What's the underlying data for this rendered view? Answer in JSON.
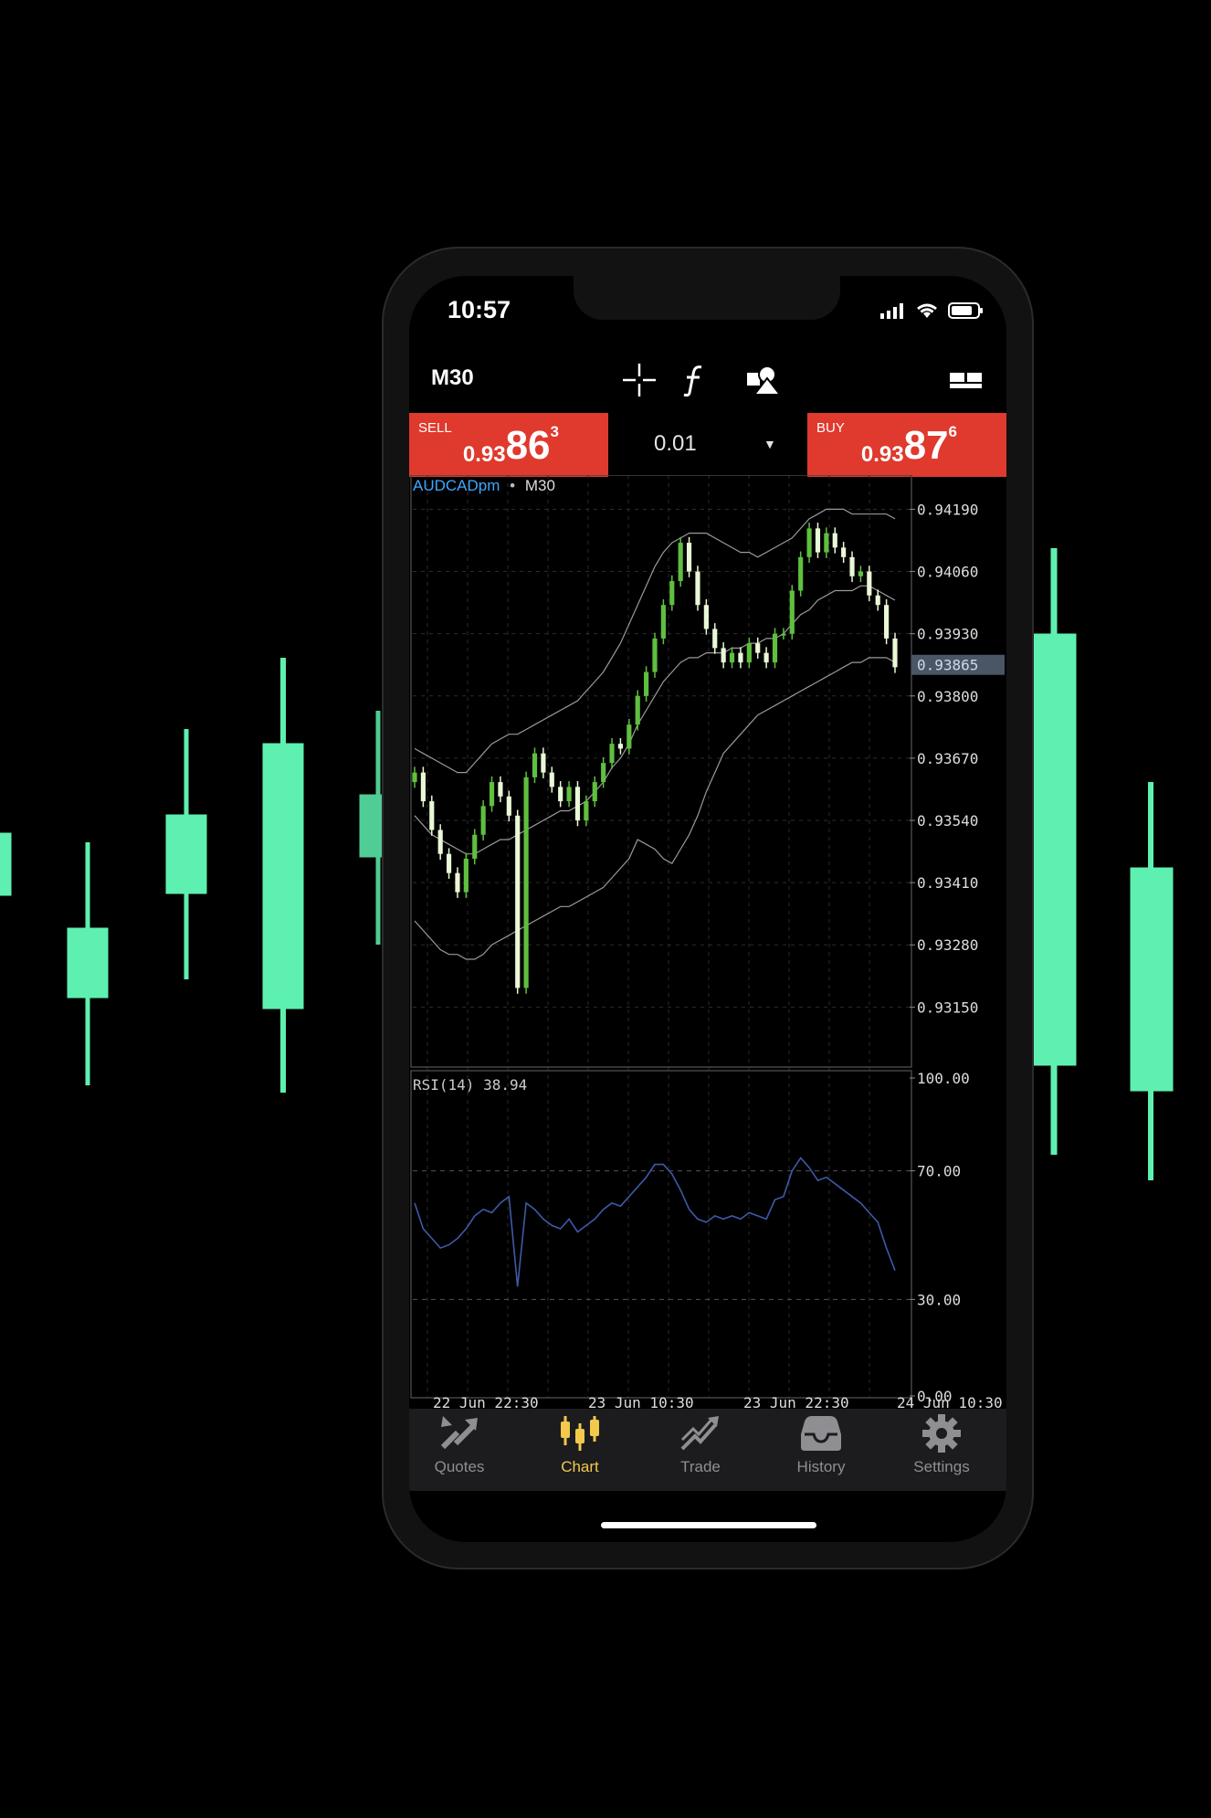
{
  "colors": {
    "background": "#000000",
    "deco_candle": "#5ef0b0",
    "sell_buy_button": "#e0392d",
    "active_tab": "#f2c94c",
    "inactive_tab": "#8e8e93",
    "candle_bull": "#5fbf3f",
    "candle_bear": "#e9f8d6",
    "rsi_line": "#3e5aa8",
    "symbol_label": "#3fa8ff"
  },
  "status_bar": {
    "time": "10:57",
    "icons": [
      "signal-icon",
      "wifi-icon",
      "battery-icon"
    ]
  },
  "toolbar": {
    "timeframe": "M30",
    "icons": [
      "crosshair-icon",
      "indicators-icon",
      "objects-icon",
      "multi-chart-icon"
    ]
  },
  "trade": {
    "sell": {
      "label": "SELL",
      "price_small": "0.93",
      "price_big": "86",
      "price_sup": "3"
    },
    "buy": {
      "label": "BUY",
      "price_small": "0.93",
      "price_big": "87",
      "price_sup": "6"
    },
    "volume": "0.01",
    "volume_caret": "▼"
  },
  "chart_data": [
    {
      "type": "candlestick",
      "symbol": "AUDCADpm",
      "symbol_separator": "•",
      "timeframe": "M30",
      "y_ticks": [
        "0.94190",
        "0.94060",
        "0.93930",
        "0.93800",
        "0.93670",
        "0.93540",
        "0.93410",
        "0.93280",
        "0.93150"
      ],
      "ylim": [
        0.9304,
        0.9425
      ],
      "current_price_label": "0.93865",
      "current_price": 0.93865,
      "x_ticks": [
        "22 Jun 22:30",
        "23 Jun 10:30",
        "23 Jun 22:30",
        "24 Jun 10:30"
      ],
      "close": [
        0.9364,
        0.9358,
        0.9352,
        0.9347,
        0.9343,
        0.9339,
        0.9346,
        0.9351,
        0.9357,
        0.9362,
        0.9359,
        0.9355,
        0.9319,
        0.9363,
        0.9368,
        0.9364,
        0.9361,
        0.9358,
        0.9361,
        0.9354,
        0.9358,
        0.9362,
        0.9366,
        0.937,
        0.9369,
        0.9374,
        0.938,
        0.9385,
        0.9392,
        0.9399,
        0.9404,
        0.9412,
        0.9406,
        0.9399,
        0.9394,
        0.939,
        0.9387,
        0.9389,
        0.9387,
        0.9391,
        0.9389,
        0.9387,
        0.9393,
        0.9393,
        0.9402,
        0.9409,
        0.9415,
        0.941,
        0.9414,
        0.9411,
        0.9409,
        0.9405,
        0.9406,
        0.9401,
        0.9399,
        0.9392,
        0.9386
      ],
      "bollinger": {
        "upper": [
          0.9369,
          0.9368,
          0.9367,
          0.9366,
          0.9365,
          0.9364,
          0.9364,
          0.9366,
          0.9368,
          0.937,
          0.9371,
          0.9372,
          0.9372,
          0.9373,
          0.9374,
          0.9375,
          0.9376,
          0.9377,
          0.9378,
          0.9379,
          0.9381,
          0.9383,
          0.9385,
          0.9388,
          0.9391,
          0.9395,
          0.9399,
          0.9403,
          0.9407,
          0.941,
          0.9412,
          0.9413,
          0.9414,
          0.9414,
          0.9414,
          0.9413,
          0.9412,
          0.9411,
          0.941,
          0.941,
          0.9409,
          0.941,
          0.9411,
          0.9412,
          0.9413,
          0.9415,
          0.9417,
          0.9418,
          0.9419,
          0.9419,
          0.9419,
          0.9418,
          0.9418,
          0.9418,
          0.9418,
          0.9418,
          0.9417
        ],
        "middle": [
          0.9355,
          0.9353,
          0.9351,
          0.935,
          0.9349,
          0.9348,
          0.9347,
          0.9347,
          0.9348,
          0.9349,
          0.935,
          0.935,
          0.9351,
          0.9352,
          0.9353,
          0.9354,
          0.9355,
          0.9356,
          0.9356,
          0.9357,
          0.9358,
          0.936,
          0.9362,
          0.9365,
          0.9367,
          0.937,
          0.9374,
          0.9377,
          0.938,
          0.9383,
          0.9385,
          0.9387,
          0.9388,
          0.9388,
          0.9389,
          0.9389,
          0.9389,
          0.939,
          0.939,
          0.9391,
          0.9391,
          0.9392,
          0.9392,
          0.9393,
          0.9395,
          0.9397,
          0.9398,
          0.94,
          0.9401,
          0.9402,
          0.9402,
          0.9402,
          0.9403,
          0.9403,
          0.9402,
          0.9401,
          0.94
        ],
        "lower": [
          0.9333,
          0.9331,
          0.9329,
          0.9327,
          0.9326,
          0.9326,
          0.9325,
          0.9325,
          0.9326,
          0.9328,
          0.9329,
          0.933,
          0.9331,
          0.9332,
          0.9333,
          0.9334,
          0.9335,
          0.9336,
          0.9336,
          0.9337,
          0.9338,
          0.9339,
          0.934,
          0.9342,
          0.9344,
          0.9346,
          0.935,
          0.9349,
          0.9348,
          0.9346,
          0.9345,
          0.9348,
          0.9351,
          0.9355,
          0.936,
          0.9364,
          0.9368,
          0.937,
          0.9372,
          0.9374,
          0.9376,
          0.9377,
          0.9378,
          0.9379,
          0.938,
          0.9381,
          0.9382,
          0.9383,
          0.9384,
          0.9385,
          0.9386,
          0.9387,
          0.9387,
          0.9388,
          0.9388,
          0.9388,
          0.9387
        ]
      }
    },
    {
      "type": "line",
      "title": "RSI(14) 38.94",
      "y_ticks": [
        "100.00",
        "70.00",
        "30.00",
        "0.00"
      ],
      "ylim": [
        0,
        100
      ],
      "values": [
        60,
        52,
        49,
        46,
        47,
        49,
        52,
        56,
        58,
        57,
        60,
        62,
        34,
        60,
        58,
        55,
        53,
        52,
        55,
        51,
        53,
        55,
        58,
        60,
        59,
        62,
        65,
        68,
        72,
        72,
        69,
        64,
        58,
        55,
        54,
        56,
        55,
        56,
        55,
        57,
        56,
        55,
        61,
        62,
        70,
        74,
        71,
        67,
        68,
        66,
        64,
        62,
        60,
        57,
        54,
        46,
        39
      ]
    }
  ],
  "tabs": [
    {
      "label": "Quotes",
      "icon": "quotes-icon",
      "active": false
    },
    {
      "label": "Chart",
      "icon": "chart-icon",
      "active": true
    },
    {
      "label": "Trade",
      "icon": "trade-icon",
      "active": false
    },
    {
      "label": "History",
      "icon": "history-icon",
      "active": false
    },
    {
      "label": "Settings",
      "icon": "settings-icon",
      "active": false
    }
  ]
}
